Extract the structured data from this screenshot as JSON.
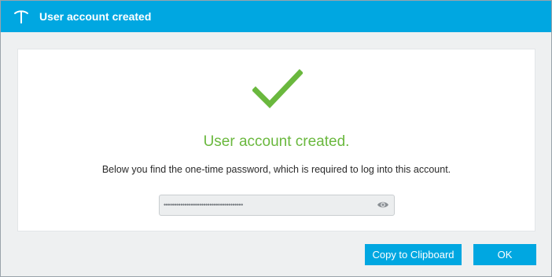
{
  "dialog": {
    "title": "User account created",
    "title_icon": "pickaxe-logo-icon",
    "accent_color": "#00a7e1"
  },
  "content": {
    "status_icon": "checkmark-icon",
    "status_color": "#6ab83e",
    "headline": "User account created.",
    "message": "Below you find the one-time password, which is required to log into this account.",
    "password_masked": "••••••••••••••••••••••••••••••••••••••",
    "reveal_icon": "eye-icon"
  },
  "buttons": {
    "copy_label": "Copy to Clipboard",
    "ok_label": "OK"
  }
}
